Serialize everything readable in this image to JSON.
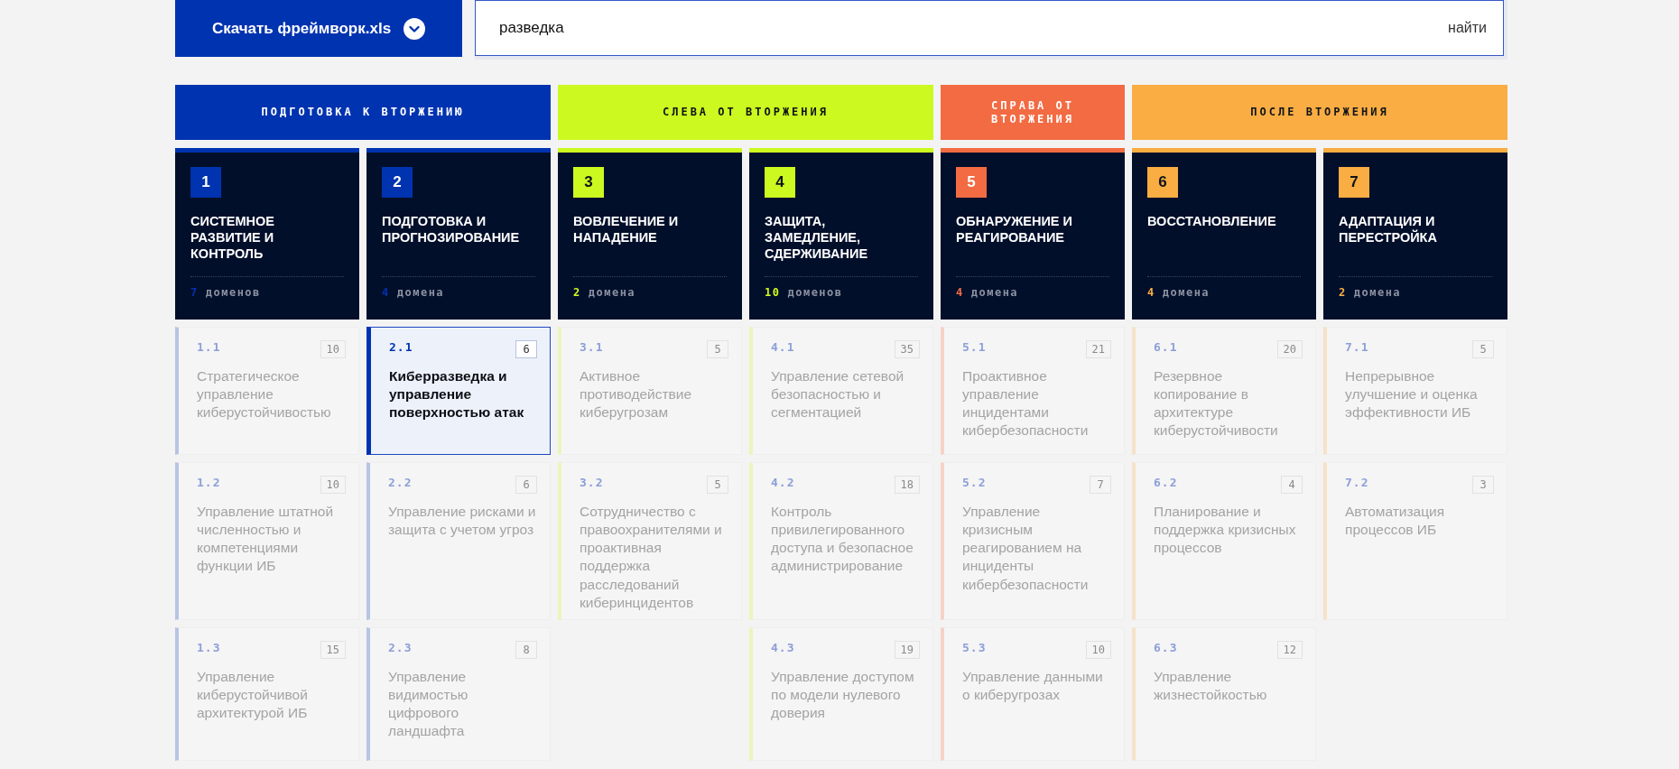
{
  "download_button": {
    "label": "Скачать фреймворк.xls"
  },
  "search": {
    "value": "разведка",
    "button": "найти"
  },
  "phases": [
    {
      "label": "ПОДГОТОВКА К ВТОРЖЕНИЮ",
      "color": "#0033b0",
      "columns": [
        {
          "number": "1",
          "title": "СИСТЕМНОЕ РАЗВИТИЕ И КОНТРОЛЬ",
          "count": "7",
          "count_label": "доменов",
          "domains": [
            {
              "code": "1.1",
              "count": "10",
              "title": "Стратегическое управление киберустойчивостью",
              "selected": false
            },
            {
              "code": "1.2",
              "count": "10",
              "title": "Управление штатной численностью и компетенциями функции ИБ",
              "selected": false
            },
            {
              "code": "1.3",
              "count": "15",
              "title": "Управление киберустойчивой архитектурой ИБ",
              "selected": false
            }
          ]
        },
        {
          "number": "2",
          "title": "ПОДГОТОВКА И ПРОГНОЗИРОВАНИЕ",
          "count": "4",
          "count_label": "домена",
          "domains": [
            {
              "code": "2.1",
              "count": "6",
              "title": "Киберразведка и управление поверхностью атак",
              "selected": true
            },
            {
              "code": "2.2",
              "count": "6",
              "title": "Управление рисками и защита с учетом угроз",
              "selected": false
            },
            {
              "code": "2.3",
              "count": "8",
              "title": "Управление видимостью цифрового ландшафта",
              "selected": false
            }
          ]
        }
      ]
    },
    {
      "label": "СЛЕВА ОТ ВТОРЖЕНИЯ",
      "color": "#ccf91f",
      "columns": [
        {
          "number": "3",
          "title": "ВОВЛЕЧЕНИЕ И НАПАДЕНИЕ",
          "count": "2",
          "count_label": "домена",
          "domains": [
            {
              "code": "3.1",
              "count": "5",
              "title": "Активное противодействие киберугрозам",
              "selected": false
            },
            {
              "code": "3.2",
              "count": "5",
              "title": "Сотрудничество с правоохранителями и проактивная поддержка расследований киберинцидентов",
              "selected": false
            }
          ]
        },
        {
          "number": "4",
          "title": "ЗАЩИТА, ЗАМЕДЛЕНИЕ, СДЕРЖИВАНИЕ",
          "count": "10",
          "count_label": "доменов",
          "domains": [
            {
              "code": "4.1",
              "count": "35",
              "title": "Управление сетевой безопасностью и сегментацией",
              "selected": false
            },
            {
              "code": "4.2",
              "count": "18",
              "title": "Контроль привилегированного доступа и безопасное администрирование",
              "selected": false
            },
            {
              "code": "4.3",
              "count": "19",
              "title": "Управление доступом по модели нулевого доверия",
              "selected": false
            }
          ]
        }
      ]
    },
    {
      "label": "СПРАВА ОТ ВТОРЖЕНИЯ",
      "color": "#f26b43",
      "columns": [
        {
          "number": "5",
          "title": "ОБНАРУЖЕНИЕ И РЕАГИРОВАНИЕ",
          "count": "4",
          "count_label": "домена",
          "domains": [
            {
              "code": "5.1",
              "count": "21",
              "title": "Проактивное управление инцидентами кибербезопасности",
              "selected": false
            },
            {
              "code": "5.2",
              "count": "7",
              "title": "Управление кризисным реагированием на инциденты кибербезопасности",
              "selected": false
            },
            {
              "code": "5.3",
              "count": "10",
              "title": "Управление данными о киберугрозах",
              "selected": false
            }
          ]
        }
      ]
    },
    {
      "label": "ПОСЛЕ ВТОРЖЕНИЯ",
      "color": "#f9ad42",
      "columns": [
        {
          "number": "6",
          "title": "ВОССТАНОВЛЕНИЕ",
          "count": "4",
          "count_label": "домена",
          "domains": [
            {
              "code": "6.1",
              "count": "20",
              "title": "Резервное копирование в архитектуре киберустойчивости",
              "selected": false
            },
            {
              "code": "6.2",
              "count": "4",
              "title": "Планирование и поддержка кризисных процессов",
              "selected": false
            },
            {
              "code": "6.3",
              "count": "12",
              "title": "Управление жизнестойкостью",
              "selected": false
            }
          ]
        },
        {
          "number": "7",
          "title": "АДАПТАЦИЯ И ПЕРЕСТРОЙКА",
          "count": "2",
          "count_label": "домена",
          "domains": [
            {
              "code": "7.1",
              "count": "5",
              "title": "Непрерывное улучшение и оценка эффективности ИБ",
              "selected": false
            },
            {
              "code": "7.2",
              "count": "3",
              "title": "Автоматизация процессов ИБ",
              "selected": false
            }
          ]
        }
      ]
    }
  ]
}
